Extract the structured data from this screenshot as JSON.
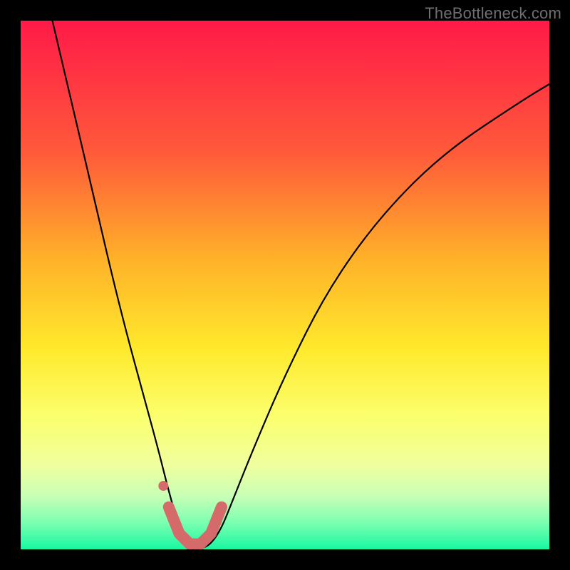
{
  "watermark": "TheBottleneck.com",
  "colors": {
    "gradient_top": "#ff1a48",
    "gradient_bottom": "#18f7a2",
    "curve": "#000000",
    "marker": "#d46a6a",
    "frame_background": "#000000"
  },
  "chart_data": {
    "type": "line",
    "title": "",
    "xlabel": "",
    "ylabel": "",
    "xlim": [
      0,
      100
    ],
    "ylim": [
      0,
      100
    ],
    "grid": false,
    "legend": false,
    "series": [
      {
        "name": "bottleneck-curve",
        "x": [
          6,
          10,
          14,
          17,
          20,
          23,
          26,
          28,
          30,
          31,
          32,
          34,
          36,
          38,
          40,
          44,
          50,
          58,
          68,
          80,
          95,
          100
        ],
        "values": [
          100,
          83,
          66,
          53,
          41,
          30,
          19,
          11,
          4,
          1,
          0,
          0,
          1,
          4,
          9,
          19,
          33,
          49,
          63,
          75,
          85,
          88
        ]
      }
    ],
    "annotations": [
      {
        "name": "optimal-range-marker",
        "type": "path",
        "points_x": [
          28,
          30,
          32,
          34,
          36,
          38
        ],
        "points_y": [
          8,
          3,
          1,
          1,
          3,
          8
        ]
      },
      {
        "name": "marker-dot",
        "type": "point",
        "x": 27,
        "y": 12
      }
    ]
  }
}
